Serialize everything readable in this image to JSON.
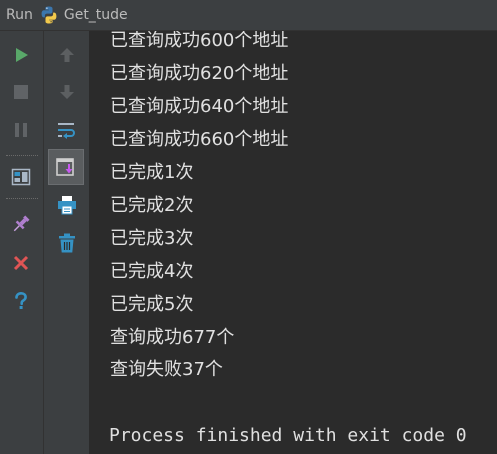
{
  "titlebar": {
    "run_label": "Run",
    "config_name": "Get_tude",
    "icon": "python-icon"
  },
  "left_toolbar": {
    "buttons": [
      {
        "name": "rerun-button",
        "icon": "play-icon",
        "color": "#59a869"
      },
      {
        "name": "stop-button",
        "icon": "stop-icon",
        "color": "#6e6e6e"
      },
      {
        "name": "pause-button",
        "icon": "pause-icon",
        "color": "#6e6e6e"
      },
      {
        "name": "restore-layout-button",
        "icon": "layout-icon"
      },
      {
        "name": "pin-tab-button",
        "icon": "pin-icon",
        "color": "#b07fcf"
      },
      {
        "name": "close-button",
        "icon": "close-icon",
        "color": "#e05555"
      },
      {
        "name": "help-button",
        "icon": "question-icon",
        "color": "#3592c4"
      }
    ]
  },
  "right_toolbar": {
    "buttons": [
      {
        "name": "up-stack-button",
        "icon": "arrow-up-icon"
      },
      {
        "name": "down-stack-button",
        "icon": "arrow-down-icon"
      },
      {
        "name": "soft-wrap-button",
        "icon": "soft-wrap-icon"
      },
      {
        "name": "scroll-to-end-button",
        "icon": "scroll-to-end-icon",
        "active": true
      },
      {
        "name": "print-button",
        "icon": "print-icon"
      },
      {
        "name": "clear-all-button",
        "icon": "trash-icon"
      }
    ]
  },
  "console": {
    "lines": [
      "已查询成功600个地址",
      "已查询成功620个地址",
      "已查询成功640个地址",
      "已查询成功660个地址",
      "已完成1次",
      "已完成2次",
      "已完成3次",
      "已完成4次",
      "已完成5次",
      "查询成功677个",
      "查询失败37个",
      "",
      "Process finished with exit code 0"
    ]
  },
  "colors": {
    "background": "#2b2b2b",
    "toolbar_bg": "#3c3f41",
    "text": "#e0e0e0"
  }
}
